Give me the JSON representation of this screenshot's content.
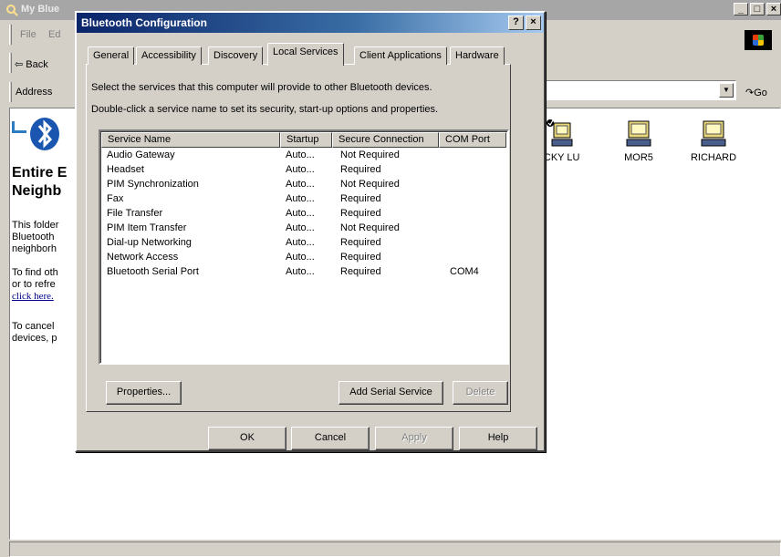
{
  "background_window": {
    "title": "My Blue",
    "menu": [
      "File",
      "Ed"
    ],
    "back_label": "Back",
    "address_label": "Address",
    "go_label": "Go",
    "heading_lines": [
      "Entire E",
      "Neighb"
    ],
    "info_lines": [
      "This folder",
      "Bluetooth",
      "neighborh"
    ],
    "find_lines": [
      "To find oth",
      "or to refre"
    ],
    "link_text": "click here.",
    "cancel_lines": [
      "To cancel",
      "devices, p"
    ],
    "devices": [
      {
        "name": "ACKY LU"
      },
      {
        "name": "MOR5"
      },
      {
        "name": "RICHARD"
      }
    ],
    "controls": [
      "_",
      "□",
      "×"
    ]
  },
  "dialog": {
    "title": "Bluetooth Configuration",
    "help_button": "?",
    "close_button": "×",
    "tabs": [
      {
        "label": "General"
      },
      {
        "label": "Accessibility"
      },
      {
        "label": "Discovery"
      },
      {
        "label": "Local Services"
      },
      {
        "label": "Client Applications"
      },
      {
        "label": "Hardware"
      }
    ],
    "active_tab": "Local Services",
    "description_1": "Select the services that this computer will provide to other Bluetooth devices.",
    "description_2": "Double-click a service name to set its security, start-up options and properties.",
    "columns": [
      "Service Name",
      "Startup",
      "Secure Connection",
      "COM Port"
    ],
    "services": [
      {
        "name": "Audio Gateway",
        "startup": "Auto...",
        "secure": "Not Required",
        "com": ""
      },
      {
        "name": "Headset",
        "startup": "Auto...",
        "secure": "Required",
        "com": ""
      },
      {
        "name": "PIM Synchronization",
        "startup": "Auto...",
        "secure": "Not Required",
        "com": ""
      },
      {
        "name": "Fax",
        "startup": "Auto...",
        "secure": "Required",
        "com": ""
      },
      {
        "name": "File Transfer",
        "startup": "Auto...",
        "secure": "Required",
        "com": ""
      },
      {
        "name": "PIM Item Transfer",
        "startup": "Auto...",
        "secure": "Not Required",
        "com": ""
      },
      {
        "name": "Dial-up Networking",
        "startup": "Auto...",
        "secure": "Required",
        "com": ""
      },
      {
        "name": "Network Access",
        "startup": "Auto...",
        "secure": "Required",
        "com": ""
      },
      {
        "name": "Bluetooth Serial Port",
        "startup": "Auto...",
        "secure": "Required",
        "com": "COM4"
      }
    ],
    "buttons": {
      "properties": "Properties...",
      "add_serial": "Add Serial Service",
      "delete": "Delete",
      "ok": "OK",
      "cancel": "Cancel",
      "apply": "Apply",
      "help": "Help"
    }
  }
}
